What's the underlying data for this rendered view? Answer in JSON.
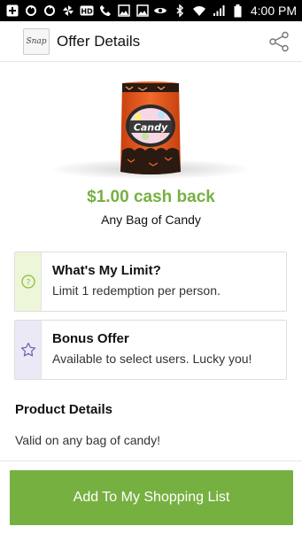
{
  "status_bar": {
    "time": "4:00 PM",
    "left_icons": [
      "add-box-icon",
      "sync-icon",
      "sync-icon",
      "pinwheel-icon",
      "hd-icon",
      "phone-icon",
      "image-icon",
      "image-icon"
    ],
    "right_icons": [
      "eye-icon",
      "bluetooth-icon",
      "wifi-icon",
      "signal-icon",
      "battery-icon"
    ]
  },
  "app_bar": {
    "logo_text": "Snap",
    "title": "Offer Details",
    "share_icon": "share-icon"
  },
  "offer": {
    "cash_back": "$1.00 cash back",
    "product_name": "Any Bag of Candy",
    "bag_label": "Candy"
  },
  "limit_card": {
    "title": "What's My Limit?",
    "text": "Limit 1 redemption per person.",
    "icon": "question-circle-icon"
  },
  "bonus_card": {
    "title": "Bonus Offer",
    "text": "Available to select users. Lucky you!",
    "icon": "star-icon"
  },
  "product_details": {
    "heading": "Product Details",
    "text": "Valid on any bag of candy!"
  },
  "cta": {
    "label": "Add To My Shopping List"
  },
  "colors": {
    "accent": "#76b041",
    "limit_strip": "#eef6d9",
    "bonus_strip": "#ebe9f6",
    "bag_orange": "#e8551e"
  }
}
